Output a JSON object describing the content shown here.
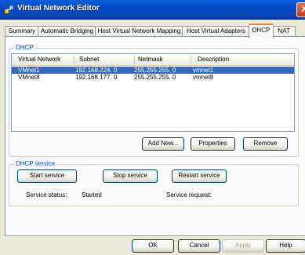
{
  "window": {
    "title": "Virtual Network Editor",
    "close_glyph": "X"
  },
  "tabs": [
    {
      "label": "Summary"
    },
    {
      "label": "Automatic Bridging"
    },
    {
      "label": "Host Virtual Network Mapping"
    },
    {
      "label": "Host Virtual Adapters"
    },
    {
      "label": "DHCP"
    },
    {
      "label": "NAT"
    }
  ],
  "dhcp": {
    "group_label": "DHCP",
    "columns": [
      "Virtual Network",
      "Subnet",
      "Netmask",
      "Description"
    ],
    "rows": [
      {
        "network": "VMnet1",
        "subnet": "192.168.224. 0",
        "netmask": "255.255.255. 0",
        "description": "vmnet1",
        "selected": true
      },
      {
        "network": "VMnet8",
        "subnet": "192.168.177. 0",
        "netmask": "255.255.255. 0",
        "description": "vmnet8",
        "selected": false
      }
    ],
    "add_new_label": "Add New...",
    "properties_label": "Properties",
    "remove_label": "Remove"
  },
  "service": {
    "group_label": "DHCP service",
    "start_label": "Start service",
    "stop_label": "Stop service",
    "restart_label": "Restart service",
    "status_label": "Service status:",
    "status_value": "Started",
    "request_label": "Service request:",
    "request_value": ""
  },
  "footer": {
    "ok_label": "OK",
    "cancel_label": "Cancel",
    "apply_label": "Apply",
    "help_label": "Help"
  },
  "colors": {
    "accent": "#0a5fd8",
    "selection": "#316ac5",
    "group_label": "#0046d5",
    "active_tab_highlight": "#e68b2c"
  }
}
